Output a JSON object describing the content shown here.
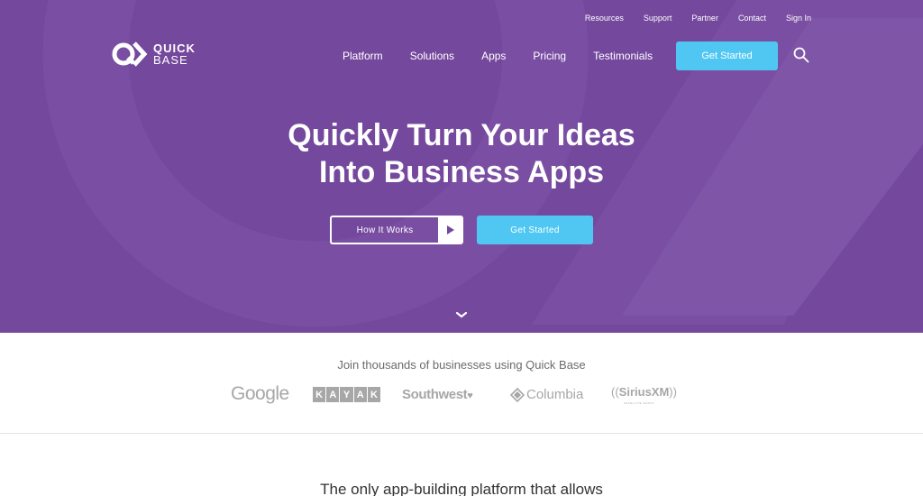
{
  "colors": {
    "hero_bg": "#74489d",
    "accent": "#4fc7f2",
    "text_white": "#ffffff",
    "logo_gray": "#a7a7a7"
  },
  "utility_nav": [
    "Resources",
    "Support",
    "Partner",
    "Contact",
    "Sign In"
  ],
  "brand": {
    "line1": "QUICK",
    "line2": "BASE",
    "icon": "quickbase-logo-icon"
  },
  "main_nav": [
    "Platform",
    "Solutions",
    "Apps",
    "Pricing",
    "Testimonials"
  ],
  "nav_cta": "Get Started",
  "search_icon": "search-icon",
  "hero": {
    "headline_line1": "Quickly Turn Your Ideas",
    "headline_line2": "Into Business Apps",
    "how_it_works": "How It Works",
    "get_started": "Get Started",
    "scroll_icon": "chevron-down-icon"
  },
  "customers": {
    "heading": "Join thousands of businesses using Quick Base",
    "logos": {
      "google": "Google",
      "kayak": [
        "K",
        "A",
        "Y",
        "A",
        "K"
      ],
      "southwest": "Southwest",
      "columbia": "Columbia",
      "sirius": "SiriusXM",
      "sirius_sub": "SATELLITE RADIO"
    }
  },
  "tagline": "The only app-building platform that allows"
}
